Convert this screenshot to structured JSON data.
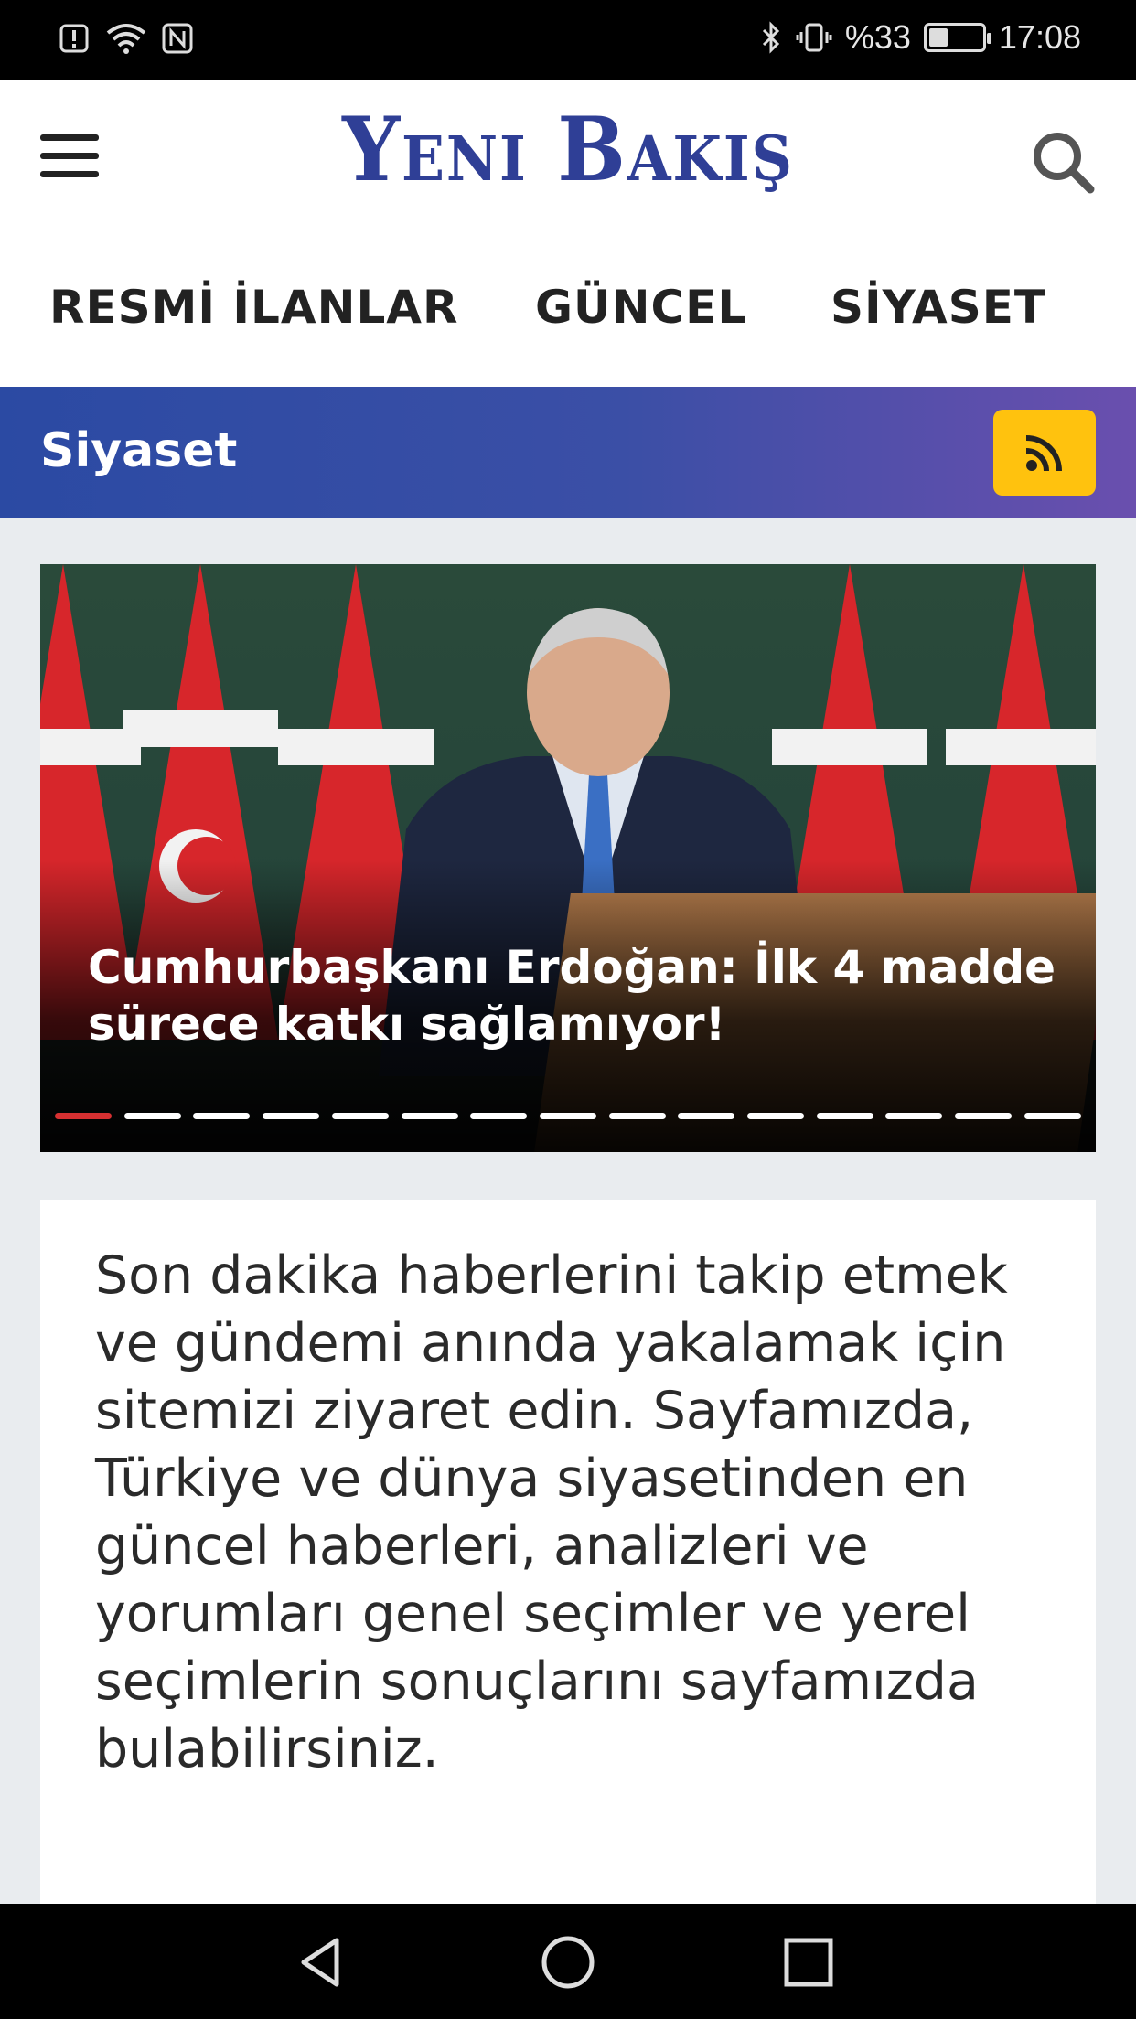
{
  "status_bar": {
    "battery_percent": "%33",
    "time": "17:08",
    "battery_level": 0.33,
    "left_icons": [
      "alert-icon",
      "wifi-icon",
      "nfc-icon"
    ],
    "right_icons": [
      "bluetooth-icon",
      "vibrate-icon"
    ]
  },
  "header": {
    "logo": "Yeni Bakış",
    "logo_color": "#2f3f96"
  },
  "nav": {
    "items": [
      "RESMİ İLANLAR",
      "GÜNCEL",
      "SİYASET"
    ]
  },
  "category": {
    "title": "Siyaset",
    "accent": "#ffc20e"
  },
  "slider": {
    "headline": "Cumhurbaşkanı Erdoğan: İlk 4 madde sürece katkı sağlamıyor!",
    "active_index": 0,
    "total_slides": 15,
    "active_color": "#d63031"
  },
  "intro": {
    "text": "Son dakika haberlerini takip etmek ve gündemi anında yakalamak için sitemizi ziyaret edin. Sayfamızda, Türkiye ve dünya siyasetinden en güncel haberleri, analizleri ve yorumları genel seçimler ve yerel seçimlerin sonuçlarını sayfamızda bulabilirsiniz."
  }
}
